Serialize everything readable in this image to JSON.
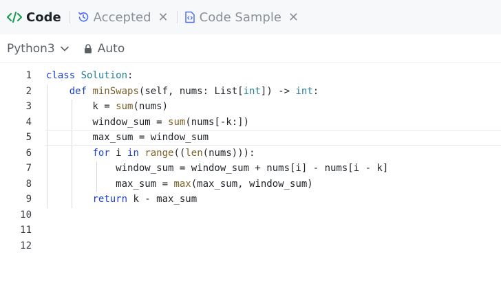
{
  "tabs": [
    {
      "label": "Code",
      "icon": "code-icon",
      "active": true
    },
    {
      "label": "Accepted",
      "icon": "history-icon",
      "active": false,
      "closable": true
    },
    {
      "label": "Code Sample",
      "icon": "file-code-icon",
      "active": false,
      "closable": true
    }
  ],
  "close_glyph": "✕",
  "toolbar": {
    "language": "Python3",
    "mode": "Auto"
  },
  "editor": {
    "line_numbers": [
      "1",
      "2",
      "3",
      "4",
      "5",
      "6",
      "7",
      "8",
      "9",
      "10",
      "11",
      "12"
    ],
    "current_line": 5,
    "code": [
      "class Solution:",
      "    def minSwaps(self, nums: List[int]) -> int:",
      "        k = sum(nums)",
      "        window_sum = sum(nums[-k:])",
      "        max_sum = window_sum",
      "        for i in range((len(nums))):",
      "            window_sum = window_sum + nums[i] - nums[i - k]",
      "            max_sum = max(max_sum, window_sum)",
      "        return k - max_sum",
      "",
      "",
      ""
    ]
  },
  "colors": {
    "accent": "#1f9d55",
    "keyword": "#1d3fce",
    "function": "#795e26",
    "type": "#267f99"
  }
}
